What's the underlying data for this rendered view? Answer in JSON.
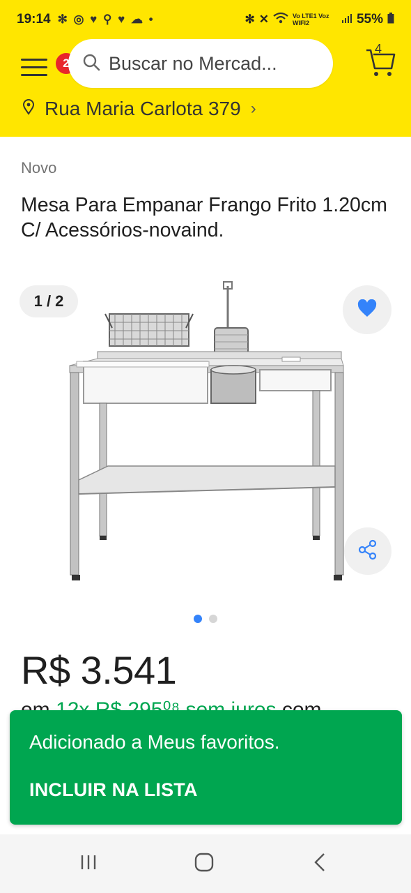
{
  "status_bar": {
    "time": "19:14",
    "notification_icons": "✻ ◎ ♥ ⚲ ♥ ☁ •",
    "network_labels": "Vo LTE1  Voz WIFI2",
    "battery": "55%"
  },
  "header": {
    "menu_badge": "2",
    "search_placeholder": "Buscar no Mercad...",
    "cart_count": "4",
    "address": "Rua Maria Carlota 379"
  },
  "product": {
    "condition": "Novo",
    "title": "Mesa Para Empanar Frango Frito 1.20cm C/ Acessórios-novaind.",
    "image_counter": "1 / 2",
    "price": "R$ 3.541",
    "installments_prefix": "em ",
    "installments_green": "12x R$ 295⁰⁸ sem juros",
    "installments_suffix": " com"
  },
  "snackbar": {
    "message": "Adicionado a Meus favoritos.",
    "action": "INCLUIR NA LISTA"
  },
  "colors": {
    "brand_yellow": "#ffe600",
    "accent_blue": "#3483fa",
    "success_green": "#00a650",
    "badge_red": "#e8262b"
  },
  "icons": [
    "menu-icon",
    "search-icon",
    "cart-icon",
    "location-pin-icon",
    "chevron-right-icon",
    "heart-icon",
    "share-icon",
    "recent-apps-icon",
    "home-icon",
    "back-icon"
  ]
}
